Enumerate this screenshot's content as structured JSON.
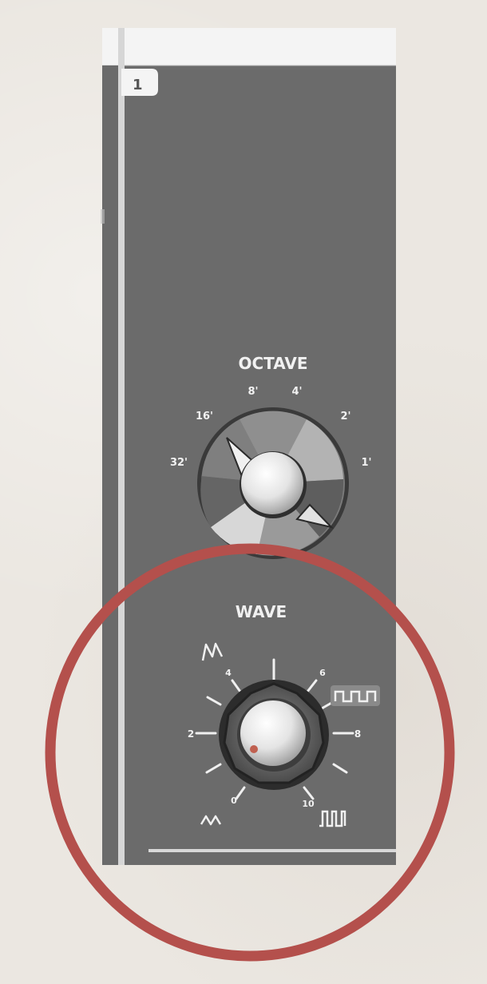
{
  "module": {
    "tab_number": "1"
  },
  "octave": {
    "title": "OCTAVE",
    "scale": [
      "32'",
      "16'",
      "8'",
      "4'",
      "2'",
      "1'"
    ],
    "selected": "16'"
  },
  "wave": {
    "title": "WAVE",
    "scale": [
      "0",
      "2",
      "4",
      "6",
      "8",
      "10"
    ],
    "value": 0
  },
  "colors": {
    "panel": "#6b6b6b",
    "highlight_circle": "#b4504c",
    "background": "#ebe7e1"
  },
  "icons": {
    "wave_top_left": "sawtooth-icon",
    "wave_bottom_left": "triangle-icon",
    "wave_right": "square-wave-icon",
    "wave_bottom_right": "pulse-wave-icon"
  }
}
